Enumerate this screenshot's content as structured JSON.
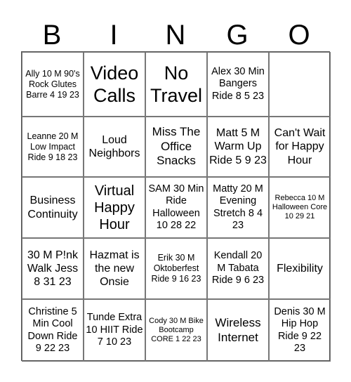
{
  "header": [
    "B",
    "I",
    "N",
    "G",
    "O"
  ],
  "cells": [
    {
      "text": "Ally 10 M 90's Rock Glutes Barre 4 19 23",
      "size": "s12"
    },
    {
      "text": "Video Calls",
      "size": "s26"
    },
    {
      "text": "No Travel",
      "size": "s26"
    },
    {
      "text": "Alex 30 Min Bangers Ride 8 5 23",
      "size": "s14"
    },
    {
      "text": "",
      "size": "tiny"
    },
    {
      "text": "Leanne 20 M Low Impact Ride 9 18 23",
      "size": "s12"
    },
    {
      "text": "Loud Neighbors",
      "size": "s16"
    },
    {
      "text": "Miss The Office Snacks",
      "size": "s17"
    },
    {
      "text": "Matt 5 M Warm Up Ride 5 9 23",
      "size": "s16"
    },
    {
      "text": "Can't Wait for Happy Hour",
      "size": "s16"
    },
    {
      "text": "Business Continuity",
      "size": "s16"
    },
    {
      "text": "Virtual Happy Hour",
      "size": "s20"
    },
    {
      "text": "SAM 30 Min Ride Halloween 10 28 22",
      "size": "s14"
    },
    {
      "text": "Matty 20 M Evening Stretch 8 4 23",
      "size": "s14"
    },
    {
      "text": "Rebecca 10 M Halloween Core 10 29 21",
      "size": "s11"
    },
    {
      "text": "30 M P!nk Walk Jess 8 31 23",
      "size": "s16"
    },
    {
      "text": "Hazmat is the new Onsie",
      "size": "s16"
    },
    {
      "text": "Erik 30 M Oktoberfest Ride 9 16 23",
      "size": "s12"
    },
    {
      "text": "Kendall 20 M Tabata Ride 9 6 23",
      "size": "s14"
    },
    {
      "text": "Flexibility",
      "size": "s16"
    },
    {
      "text": "Christine 5 Min Cool Down Ride 9 22 23",
      "size": "s14"
    },
    {
      "text": "Tunde Extra 10 HIIT Ride 7 10 23",
      "size": "s14"
    },
    {
      "text": "Cody 30 M Bike Bootcamp CORE 1 22 23",
      "size": "s11"
    },
    {
      "text": "Wireless Internet",
      "size": "s17"
    },
    {
      "text": "Denis 30 M Hip Hop Ride 9 22 23",
      "size": "s14"
    }
  ]
}
